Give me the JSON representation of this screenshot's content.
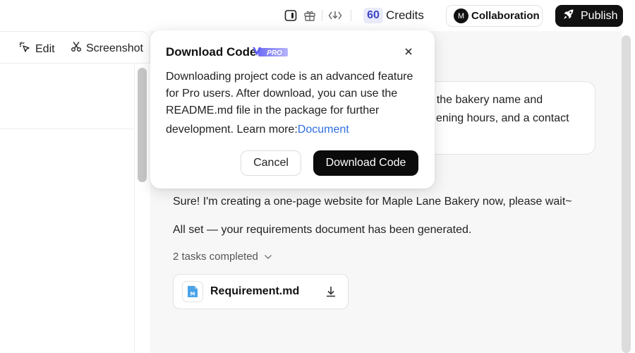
{
  "header": {
    "credits_value": "60",
    "credits_label": "Credits",
    "collaboration_avatar": "M",
    "collaboration_label": "Collaboration",
    "publish_label": "Publish",
    "icons": [
      "panel-toggle-icon",
      "gift-icon",
      "download-code-icon",
      "rocket-icon"
    ]
  },
  "left_toolbar": {
    "edit_label": "Edit",
    "screenshot_label": "Screenshot"
  },
  "chat": {
    "user_message_lines": [
      "th the bakery name and",
      "ening hours, and a contact"
    ],
    "assistant_lines": [
      "Sure! I'm creating a one-page website for Maple Lane Bakery now, please wait~",
      "All set — your requirements document has been generated."
    ],
    "tasks_label": "2 tasks completed",
    "file": {
      "name": "Requirement.md",
      "icon_letter": "M"
    }
  },
  "modal": {
    "title": "Download Code",
    "badge": "PRO",
    "body_lines": [
      "Downloading project code is an advanced feature",
      "for Pro users. After download, you can use the",
      "README.md file in the package for further"
    ],
    "last_line_prefix": "development. Learn more:",
    "link_label": "Document",
    "cancel_label": "Cancel",
    "confirm_label": "Download Code"
  },
  "colors": {
    "accent_credits": "#3d45c9",
    "link": "#2f6fe0",
    "pro_badge": "#5b5ff0",
    "chat_background": "#f7f7f8"
  }
}
